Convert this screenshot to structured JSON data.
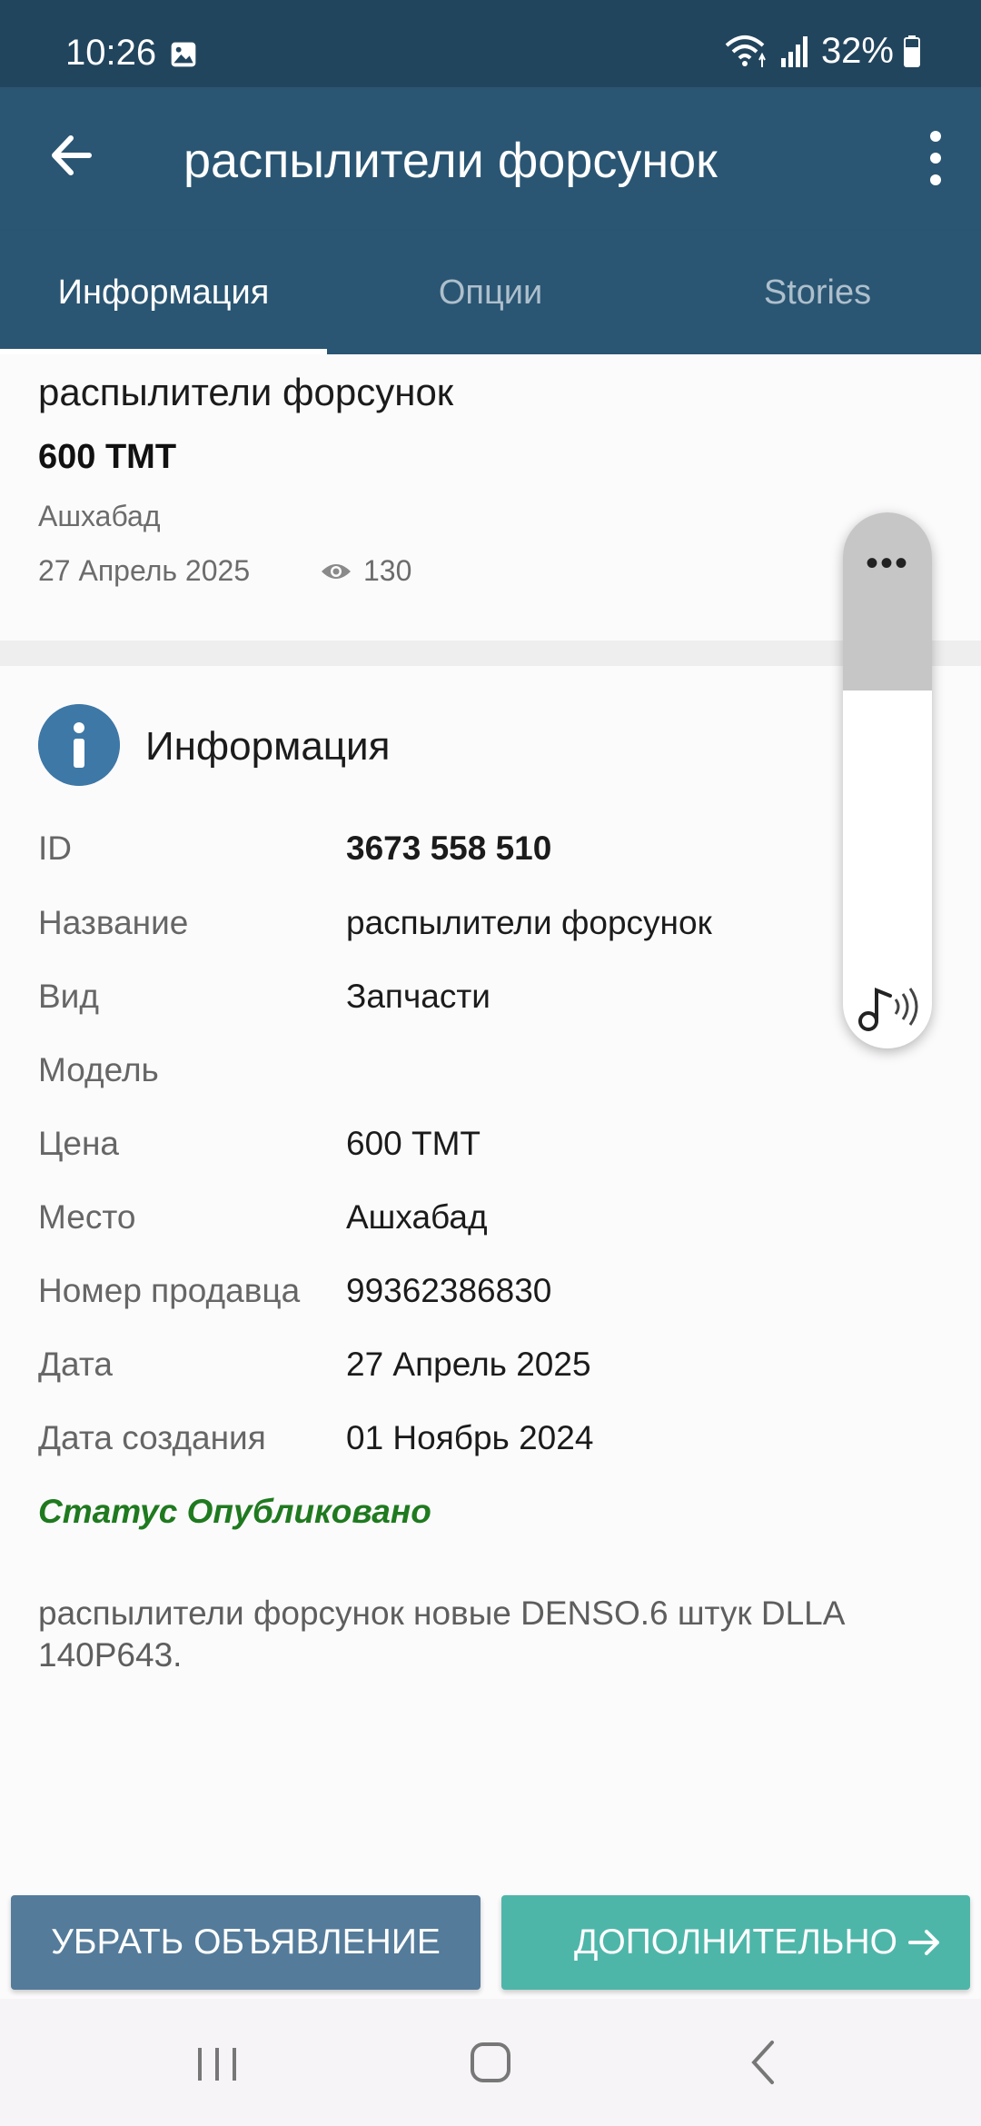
{
  "status_bar": {
    "time": "10:26",
    "battery": "32%"
  },
  "app_bar": {
    "title": "распылители форсунок"
  },
  "tabs": [
    {
      "label": "Информация",
      "active": true
    },
    {
      "label": "Опции",
      "active": false
    },
    {
      "label": "Stories",
      "active": false
    }
  ],
  "summary": {
    "title": "распылители форсунок",
    "price": "600 ТМТ",
    "city": "Ашхабад",
    "date": "27 Апрель 2025",
    "views": "130"
  },
  "info": {
    "heading": "Информация",
    "rows": [
      {
        "label": "ID",
        "value": "3673 558 510"
      },
      {
        "label": "Название",
        "value": "распылители форсунок"
      },
      {
        "label": "Вид",
        "value": "Запчасти"
      },
      {
        "label": "Модель",
        "value": ""
      },
      {
        "label": "Цена",
        "value": "600 ТМТ"
      },
      {
        "label": "Место",
        "value": "Ашхабад"
      },
      {
        "label": "Номер продавца",
        "value": "99362386830"
      },
      {
        "label": "Дата",
        "value": "27 Апрель 2025"
      },
      {
        "label": "Дата создания",
        "value": "01 Ноябрь 2024"
      }
    ],
    "status": "Статус Опубликовано",
    "description": "распылители форсунок новые DENSO.6 штук DLLA 140P643."
  },
  "buttons": {
    "remove": "УБРАТЬ ОБЪЯВЛЕНИЕ",
    "more": "ДОПОЛНИТЕЛЬНО"
  },
  "floating_panel": {
    "dots": "•••"
  },
  "colors": {
    "primary": "#2a5673",
    "status_bar": "#22455e",
    "accent_teal": "#4db6a9",
    "button_blue": "#547b9a",
    "status_green": "#1f7a1f"
  }
}
